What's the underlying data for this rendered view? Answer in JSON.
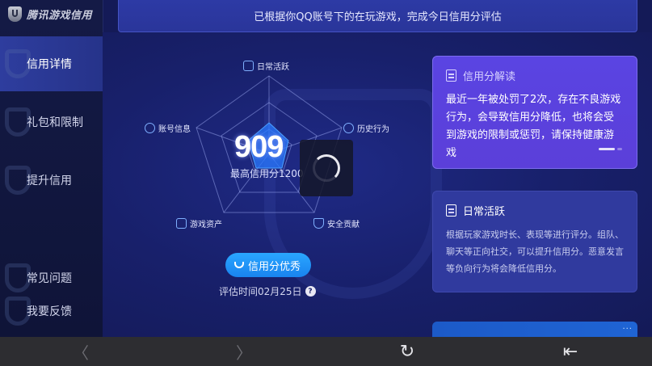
{
  "app": {
    "logo_text": "腾讯游戏信用"
  },
  "sidebar": {
    "items": [
      {
        "label": "信用详情",
        "active": true
      },
      {
        "label": "礼包和限制",
        "active": false
      },
      {
        "label": "提升信用",
        "active": false
      },
      {
        "label": "常见问题",
        "active": false
      },
      {
        "label": "我要反馈",
        "active": false
      }
    ]
  },
  "banner": {
    "text": "已根据你QQ账号下的在玩游戏，完成今日信用分评估"
  },
  "radar": {
    "axes": [
      {
        "label": "日常活跃",
        "icon": "document-icon"
      },
      {
        "label": "历史行为",
        "icon": "clock-icon"
      },
      {
        "label": "安全贡献",
        "icon": "shield-icon"
      },
      {
        "label": "游戏资产",
        "icon": "wallet-icon"
      },
      {
        "label": "账号信息",
        "icon": "user-icon"
      }
    ],
    "score": "909",
    "max_label": "最高信用分1200",
    "rating_label": "信用分优秀",
    "eval_time": "评估时间02月25日",
    "help_glyph": "?"
  },
  "cards": {
    "interpretation": {
      "title": "信用分解读",
      "body": "最近一年被处罚了2次，存在不良游戏行为，会导致信用分降低，也将会受到游戏的限制或惩罚，请保持健康游戏"
    },
    "daily": {
      "title": "日常活跃",
      "body": "根据玩家游戏时长、表现等进行评分。组队、聊天等正向社交，可以提升信用分。恶意发言等负向行为将会降低信用分。"
    },
    "more_glyph": "···"
  },
  "system_bar": {
    "back_glyph": "〈",
    "forward_glyph": "〉",
    "refresh_glyph": "↻",
    "exit_glyph": "⇤"
  },
  "colors": {
    "accent_pill": "#1e90ff",
    "card_purple": "#5a44e2",
    "sidebar_active": "#2e3d9e"
  }
}
